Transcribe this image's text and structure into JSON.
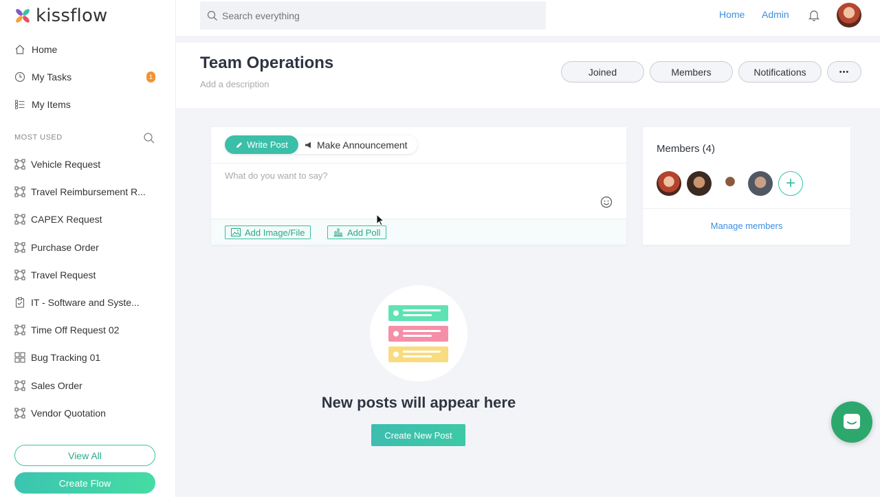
{
  "app": {
    "name": "kissflow"
  },
  "search": {
    "placeholder": "Search everything"
  },
  "topnav": {
    "home": "Home",
    "admin": "Admin"
  },
  "sidebar": {
    "nav": [
      {
        "label": "Home",
        "icon": "home-icon"
      },
      {
        "label": "My Tasks",
        "icon": "clock-icon",
        "badge": "1"
      },
      {
        "label": "My Items",
        "icon": "list-icon"
      }
    ],
    "most_used_label": "MOST USED",
    "flows": [
      {
        "label": "Vehicle Request",
        "icon": "process-icon"
      },
      {
        "label": "Travel Reimbursement R...",
        "icon": "process-icon"
      },
      {
        "label": "CAPEX Request",
        "icon": "process-icon"
      },
      {
        "label": "Purchase Order",
        "icon": "process-icon"
      },
      {
        "label": "Travel Request",
        "icon": "process-icon"
      },
      {
        "label": "IT - Software and Syste...",
        "icon": "clipboard-icon"
      },
      {
        "label": "Time Off Request 02",
        "icon": "process-icon"
      },
      {
        "label": "Bug Tracking 01",
        "icon": "grid-icon"
      },
      {
        "label": "Sales Order",
        "icon": "process-icon"
      },
      {
        "label": "Vendor Quotation",
        "icon": "process-icon"
      }
    ],
    "view_all": "View All",
    "create_flow": "Create Flow"
  },
  "header": {
    "title": "Team Operations",
    "description_placeholder": "Add a description",
    "buttons": {
      "joined": "Joined",
      "members": "Members",
      "notifications": "Notifications",
      "more": "•••"
    }
  },
  "composer": {
    "tab_write": "Write Post",
    "tab_announce": "Make Announcement",
    "placeholder": "What do you want to say?",
    "add_file": "Add Image/File",
    "add_poll": "Add Poll"
  },
  "members_card": {
    "title": "Members (4)",
    "add": "+",
    "manage": "Manage members"
  },
  "empty_state": {
    "title": "New posts will appear here",
    "button": "Create New Post"
  },
  "colors": {
    "accent": "#3bbfa8",
    "link": "#3c8ee3",
    "badge": "#f39233",
    "chat": "#2da86c"
  }
}
